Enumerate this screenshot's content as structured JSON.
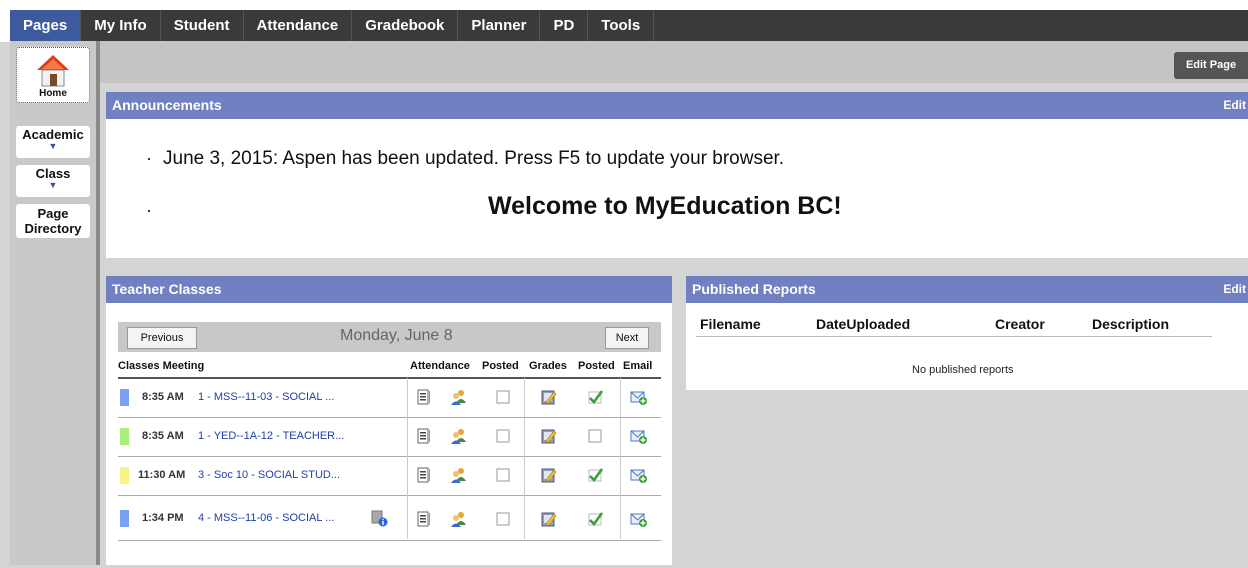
{
  "nav": {
    "tabs": [
      {
        "label": "Pages",
        "active": true
      },
      {
        "label": "My Info"
      },
      {
        "label": "Student"
      },
      {
        "label": "Attendance"
      },
      {
        "label": "Gradebook"
      },
      {
        "label": "Planner"
      },
      {
        "label": "PD"
      },
      {
        "label": "Tools"
      }
    ]
  },
  "sidebar": {
    "home": "Home",
    "academic": "Academic",
    "class": "Class",
    "page_directory_1": "Page",
    "page_directory_2": "Directory"
  },
  "toolbar": {
    "edit_page": "Edit Page"
  },
  "announcements": {
    "title": "Announcements",
    "edit": "Edit",
    "items": [
      "June 3, 2015: Aspen has been updated. Press F5 to update your browser.",
      "Welcome to MyEducation BC!"
    ]
  },
  "teacher_classes": {
    "title": "Teacher Classes",
    "previous": "Previous",
    "next": "Next",
    "date": "Monday, June 8",
    "headers": {
      "classes": "Classes Meeting",
      "attendance": "Attendance",
      "posted1": "Posted",
      "grades": "Grades",
      "posted2": "Posted",
      "email": "Email"
    },
    "rows": [
      {
        "time": "8:35 AM",
        "name": "1 - MSS--11-03 - SOCIAL ...",
        "color": "#7a9ff5",
        "att_posted": false,
        "grades_posted": true,
        "info": false
      },
      {
        "time": "8:35 AM",
        "name": "1 - YED--1A-12 - TEACHER...",
        "color": "#a8f07a",
        "att_posted": false,
        "grades_posted": false,
        "info": false
      },
      {
        "time": "11:30 AM",
        "name": "3 - Soc 10 - SOCIAL STUD...",
        "color": "#f7f58a",
        "att_posted": false,
        "grades_posted": true,
        "info": false
      },
      {
        "time": "1:34 PM",
        "name": "4 - MSS--11-06 - SOCIAL ...",
        "color": "#7a9ff5",
        "att_posted": false,
        "grades_posted": true,
        "info": true
      }
    ]
  },
  "published_reports": {
    "title": "Published Reports",
    "edit": "Edit",
    "columns": [
      "Filename",
      "DateUploaded",
      "Creator",
      "Description"
    ],
    "empty": "No published reports"
  },
  "icons": [
    "home-icon",
    "attendance-list-icon",
    "people-icon",
    "checkbox-icon",
    "gradebook-icon",
    "checkmark-icon",
    "email-add-icon",
    "info-icon",
    "arrow-down-icon"
  ]
}
